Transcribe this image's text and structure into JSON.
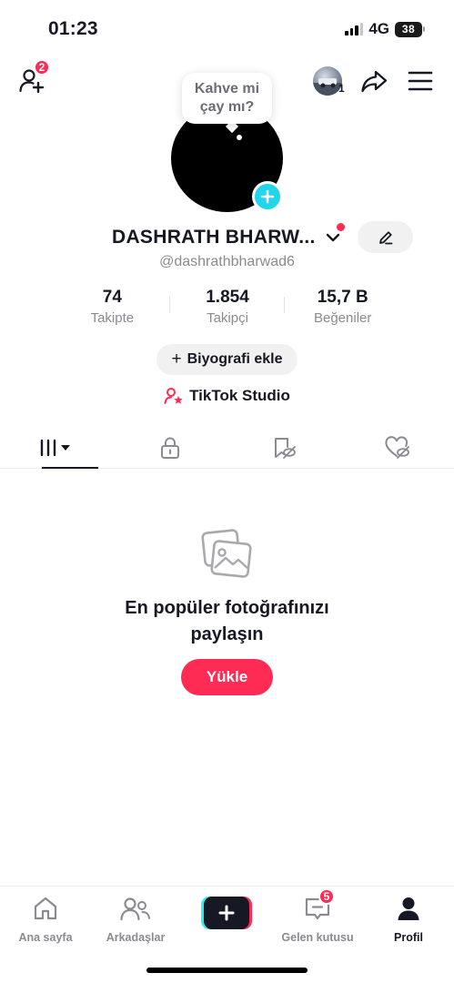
{
  "status_bar": {
    "time": "01:23",
    "network": "4G",
    "battery": "38",
    "signal_bars_filled": 3,
    "signal_bars_total": 4
  },
  "top_bar": {
    "friend_requests_badge": "2",
    "account_switch_count": "1",
    "icons": [
      "add-friend-icon",
      "account-avatar",
      "share-icon",
      "menu-icon"
    ]
  },
  "profile": {
    "bubble_text": "Kahve mi çay mı?",
    "display_name": "DASHRATH BHARW...",
    "username": "@dashrathbharwad6",
    "edit_icon": "pencil-icon"
  },
  "stats": [
    {
      "value": "74",
      "label": "Takipte"
    },
    {
      "value": "1.854",
      "label": "Takipçi"
    },
    {
      "value": "15,7 B",
      "label": "Beğeniler"
    }
  ],
  "bio_button": {
    "icon": "+",
    "label": "Biyografi ekle"
  },
  "studio_link": {
    "label": "TikTok Studio",
    "icon": "studio-person-icon"
  },
  "tabs": [
    {
      "name": "grid",
      "icon": "grid-filter-icon",
      "active": true
    },
    {
      "name": "private",
      "icon": "lock-icon",
      "active": false
    },
    {
      "name": "saved",
      "icon": "bookmark-hidden-icon",
      "active": false
    },
    {
      "name": "liked",
      "icon": "heart-hidden-icon",
      "active": false
    }
  ],
  "empty_state": {
    "title_line1": "En popüler fotoğrafınızı",
    "title_line2": "paylaşın",
    "button": "Yükle"
  },
  "bottom_nav": [
    {
      "label": "Ana sayfa",
      "icon": "home-icon"
    },
    {
      "label": "Arkadaşlar",
      "icon": "friends-icon"
    },
    {
      "label": "",
      "icon": "create-plus-icon"
    },
    {
      "label": "Gelen kutusu",
      "icon": "inbox-icon",
      "badge": "5"
    },
    {
      "label": "Profil",
      "icon": "profile-icon",
      "active": true
    }
  ],
  "colors": {
    "accent": "#fe2c55",
    "cyan": "#20d5ec",
    "text": "#161823",
    "muted": "#8a8b91"
  }
}
